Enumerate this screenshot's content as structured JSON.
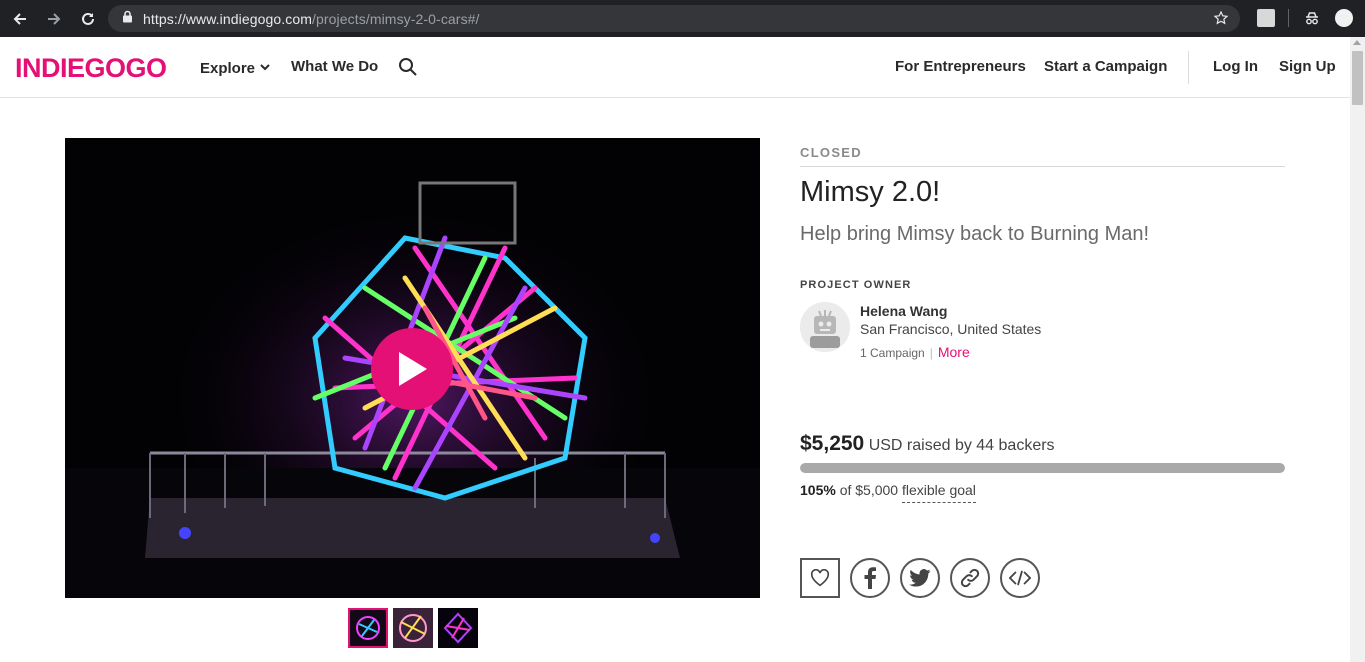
{
  "browser": {
    "url_host": "https://www.indiegogo.com",
    "url_path": "/projects/mimsy-2-0-cars#/"
  },
  "header": {
    "logo": "INDIEGOGO",
    "nav_left": [
      "Explore",
      "What We Do"
    ],
    "nav_right": [
      "For Entrepreneurs",
      "Start a Campaign"
    ],
    "auth": [
      "Log In",
      "Sign Up"
    ]
  },
  "campaign": {
    "status": "CLOSED",
    "title": "Mimsy 2.0!",
    "tagline": "Help bring Mimsy back to Burning Man!",
    "owner_label": "PROJECT OWNER",
    "owner": {
      "name": "Helena Wang",
      "location": "San Francisco, United States",
      "campaigns": "1 Campaign",
      "more": "More"
    },
    "funding": {
      "amount": "$5,250",
      "raised_text": "USD raised by 44 backers",
      "percent_text": "105%",
      "goal_text": "of $5,000",
      "goal_type": "flexible goal",
      "progress": 1.0
    }
  },
  "colors": {
    "brand": "#e51075"
  },
  "icons": [
    "back-icon",
    "forward-icon",
    "reload-icon",
    "lock-icon",
    "star-icon",
    "search-icon",
    "play-icon",
    "heart-icon",
    "facebook-icon",
    "twitter-icon",
    "link-icon",
    "embed-icon"
  ]
}
